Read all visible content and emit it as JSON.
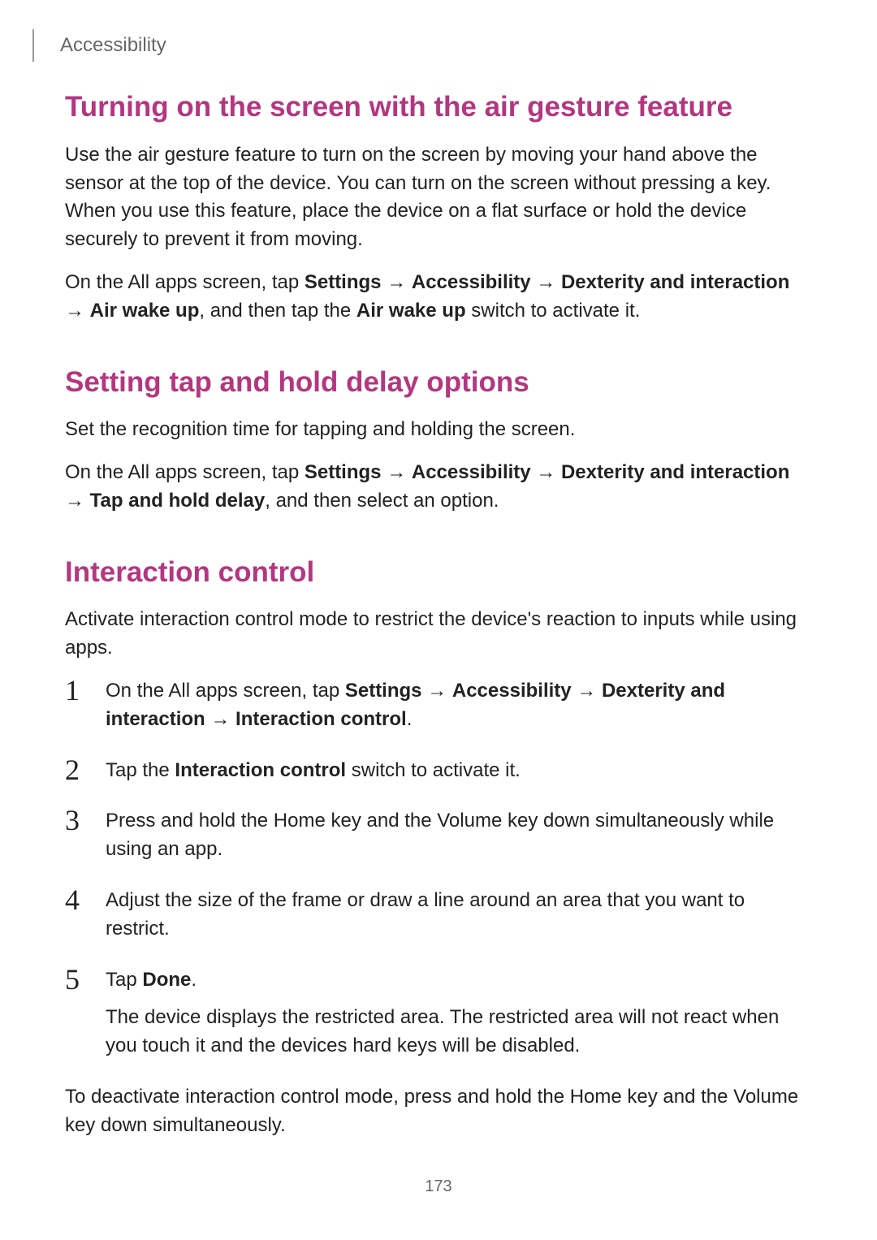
{
  "header": {
    "breadcrumb": "Accessibility"
  },
  "section1": {
    "title": "Turning on the screen with the air gesture feature",
    "para1": "Use the air gesture feature to turn on the screen by moving your hand above the sensor at the top of the device. You can turn on the screen without pressing a key. When you use this feature, place the device on a flat surface or hold the device securely to prevent it from moving.",
    "para2_pre": "On the All apps screen, tap ",
    "para2_b1": "Settings",
    "para2_arr1": " → ",
    "para2_b2": "Accessibility",
    "para2_arr2": " → ",
    "para2_b3": "Dexterity and interaction",
    "para2_arr3": " → ",
    "para2_b4": "Air wake up",
    "para2_mid": ", and then tap the ",
    "para2_b5": "Air wake up",
    "para2_post": " switch to activate it."
  },
  "section2": {
    "title": "Setting tap and hold delay options",
    "para1": "Set the recognition time for tapping and holding the screen.",
    "para2_pre": "On the All apps screen, tap ",
    "para2_b1": "Settings",
    "para2_arr1": " → ",
    "para2_b2": "Accessibility",
    "para2_arr2": " → ",
    "para2_b3": "Dexterity and interaction",
    "para2_arr3": " → ",
    "para2_b4": "Tap and hold delay",
    "para2_post": ", and then select an option."
  },
  "section3": {
    "title": "Interaction control",
    "para1": "Activate interaction control mode to restrict the device's reaction to inputs while using apps.",
    "steps": {
      "s1": {
        "num": "1",
        "pre": "On the All apps screen, tap ",
        "b1": "Settings",
        "arr1": " → ",
        "b2": "Accessibility",
        "arr2": " → ",
        "b3": "Dexterity and interaction",
        "arr3": " → ",
        "b4": "Interaction control",
        "post": "."
      },
      "s2": {
        "num": "2",
        "pre": "Tap the ",
        "b1": "Interaction control",
        "post": " switch to activate it."
      },
      "s3": {
        "num": "3",
        "text": "Press and hold the Home key and the Volume key down simultaneously while using an app."
      },
      "s4": {
        "num": "4",
        "text": "Adjust the size of the frame or draw a line around an area that you want to restrict."
      },
      "s5": {
        "num": "5",
        "pre": "Tap ",
        "b1": "Done",
        "post": ".",
        "after": "The device displays the restricted area. The restricted area will not react when you touch it and the devices hard keys will be disabled."
      }
    },
    "closing": "To deactivate interaction control mode, press and hold the Home key and the Volume key down simultaneously."
  },
  "page_number": "173"
}
